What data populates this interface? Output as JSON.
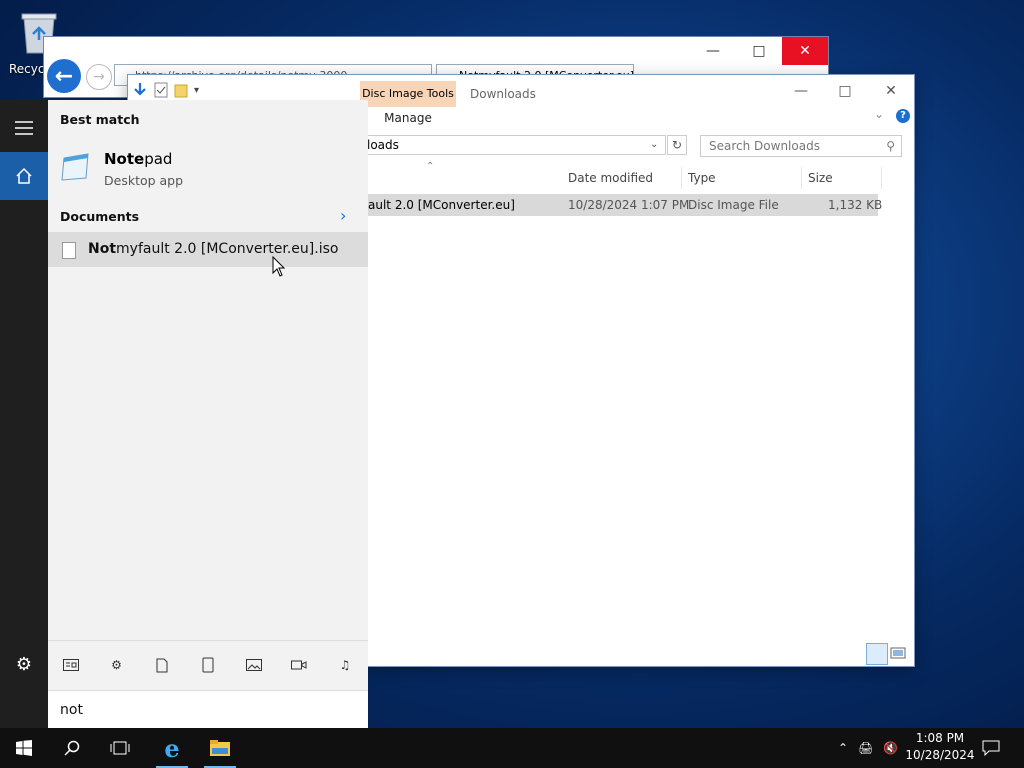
{
  "desktop": {
    "recycle_label": "Recycl"
  },
  "ie": {
    "address": "https://archive.org/details/notmy-3000",
    "tab_title": "Notmyfault 2.0 [MConverter.eu]",
    "back_label": "Back",
    "forward_label": "Forward"
  },
  "explorer": {
    "context_tab": "Disc Image Tools",
    "window_title": "Downloads",
    "ribbon_tab": "Manage",
    "path": "loads",
    "search_placeholder": "Search Downloads",
    "columns": [
      "Date modified",
      "Type",
      "Size"
    ],
    "file": {
      "name": "ault 2.0 [MConverter.eu]",
      "date": "10/28/2024 1:07 PM",
      "type": "Disc Image File",
      "size": "1,132 KB"
    }
  },
  "start": {
    "best_match": "Best match",
    "app": {
      "highlight": "Note",
      "rest": "pad",
      "sub": "Desktop app"
    },
    "documents": "Documents",
    "doc": {
      "highlight": "Not",
      "rest": "myfault 2.0 [MConverter.eu].iso"
    },
    "query": "not",
    "filters": [
      "apps-filter-icon",
      "settings-filter-icon",
      "documents-filter-icon",
      "tablet-filter-icon",
      "photos-filter-icon",
      "videos-filter-icon",
      "music-filter-icon"
    ]
  },
  "taskbar": {
    "time": "1:08 PM",
    "date": "10/28/2024"
  }
}
